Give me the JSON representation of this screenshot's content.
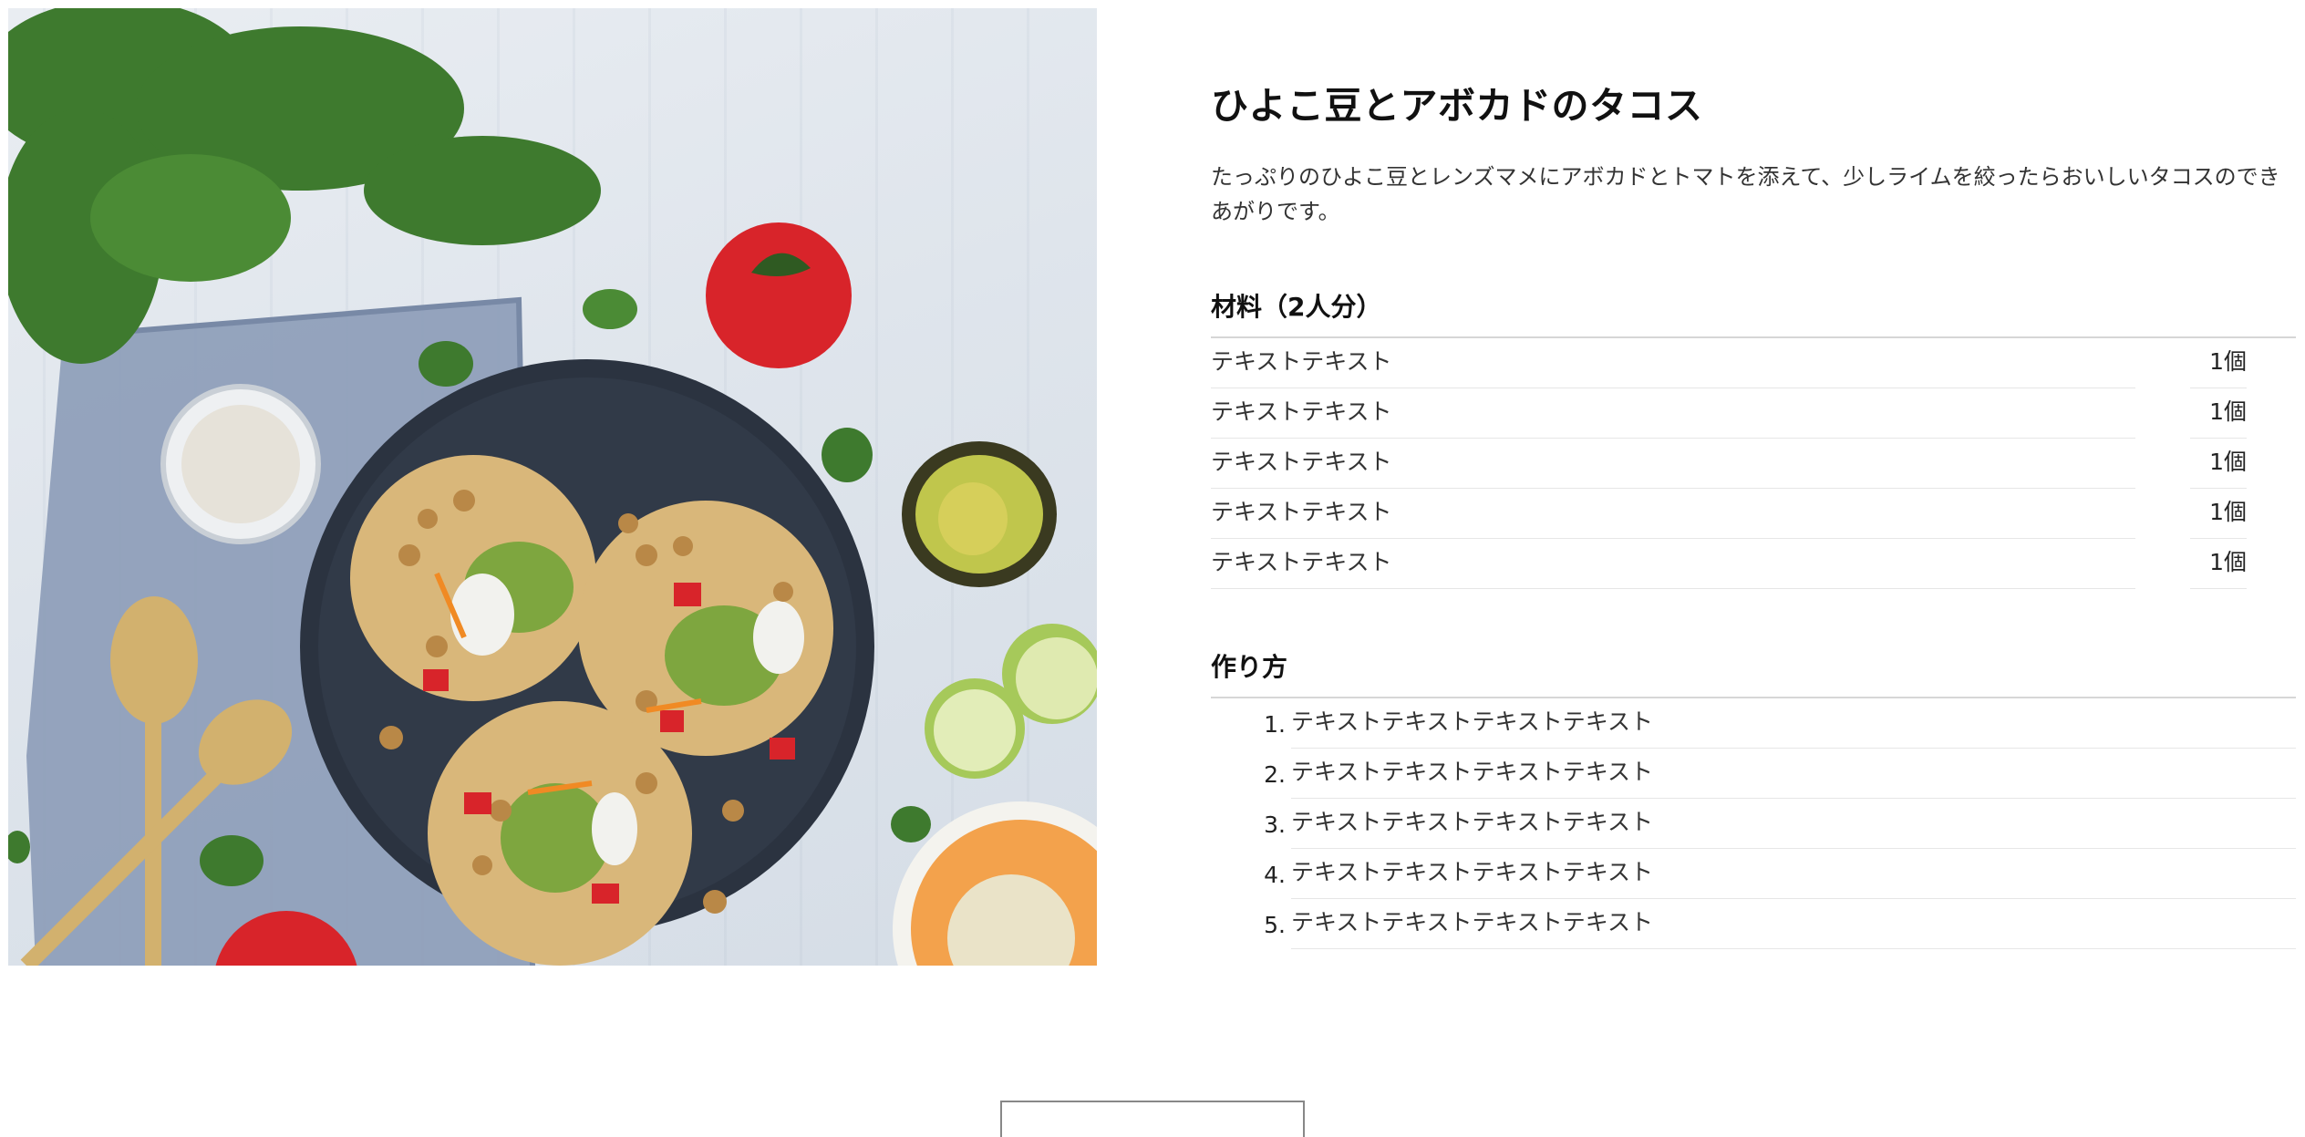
{
  "recipe": {
    "title": "ひよこ豆とアボカドのタコス",
    "description": "たっぷりのひよこ豆とレンズマメにアボカドとトマトを添えて、少しライムを絞ったらおいしいタコスのできあがりです。",
    "ingredients_heading": "材料（2人分）",
    "ingredients": [
      {
        "name": "テキストテキスト",
        "qty": "1個"
      },
      {
        "name": "テキストテキスト",
        "qty": "1個"
      },
      {
        "name": "テキストテキスト",
        "qty": "1個"
      },
      {
        "name": "テキストテキスト",
        "qty": "1個"
      },
      {
        "name": "テキストテキスト",
        "qty": "1個"
      }
    ],
    "steps_heading": "作り方",
    "steps": [
      {
        "num": "1.",
        "text": "テキストテキストテキストテキスト"
      },
      {
        "num": "2.",
        "text": "テキストテキストテキストテキスト"
      },
      {
        "num": "3.",
        "text": "テキストテキストテキストテキスト"
      },
      {
        "num": "4.",
        "text": "テキストテキストテキストテキスト"
      },
      {
        "num": "5.",
        "text": "テキストテキストテキストテキスト"
      }
    ]
  },
  "photo": {
    "subject": "tacos-photo",
    "colors": {
      "table": "#e2e8ee",
      "plate": "#2b3340",
      "napkin": "#8d9db8",
      "tortilla": "#d9b77a",
      "tomato": "#d8242a",
      "cilantro": "#3e7a2e",
      "avocado": "#b9c24a",
      "gold": "#d2b16e"
    }
  }
}
